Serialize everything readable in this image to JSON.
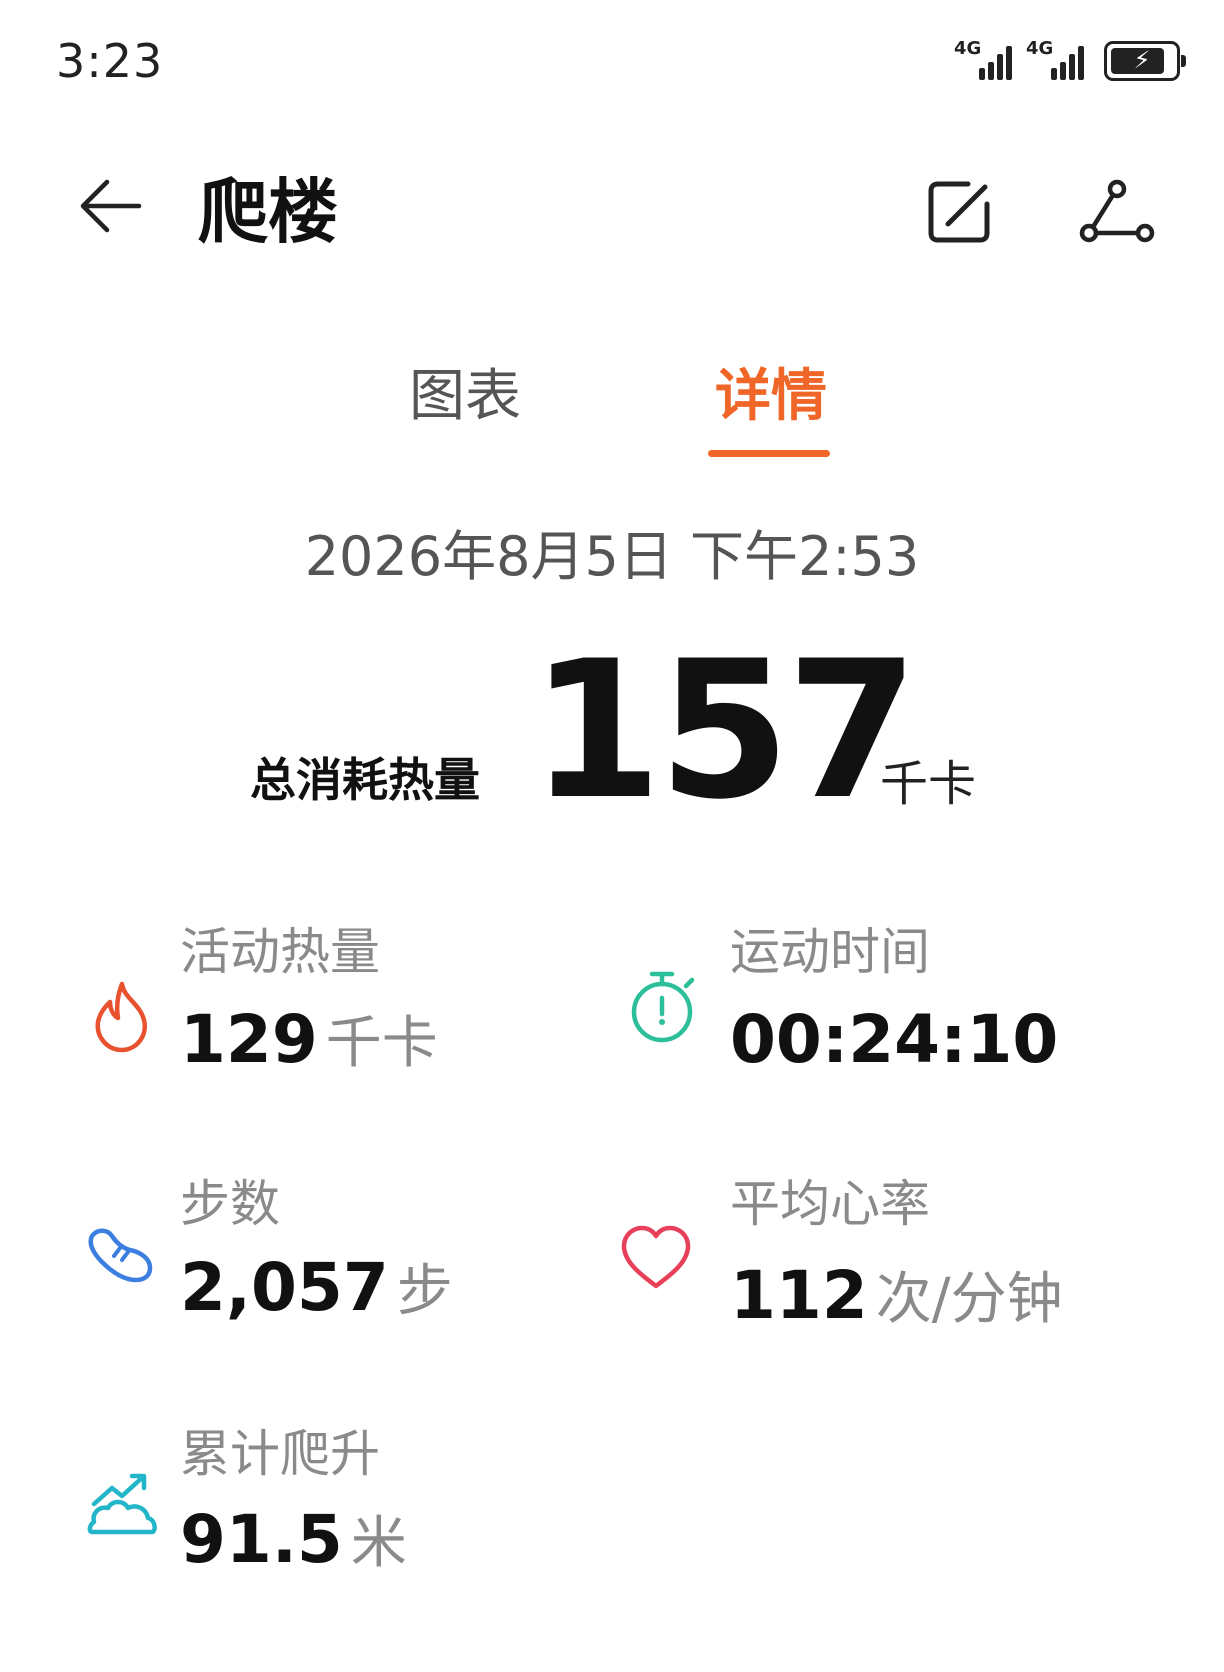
{
  "status_bar": {
    "time": "3:23",
    "networks": [
      {
        "label": "4G",
        "icon": "signal-4g-icon"
      },
      {
        "label": "4G",
        "icon": "signal-4g-icon"
      }
    ],
    "battery_icon": "battery-charging-icon",
    "battery_level": 0.85
  },
  "header": {
    "title": "爬楼",
    "back_icon": "arrow-left-icon",
    "edit_icon": "edit-note-icon",
    "share_icon": "share-icon"
  },
  "tabs": [
    {
      "label": "图表",
      "active": false
    },
    {
      "label": "详情",
      "active": true
    }
  ],
  "record": {
    "datetime": "2026年8月5日 下午2:53"
  },
  "total": {
    "label": "总消耗热量",
    "value": "157",
    "unit": "千卡"
  },
  "metrics": [
    {
      "label": "活动热量",
      "value": "129",
      "unit": "千卡",
      "icon": "flame-icon",
      "color": "#e8522e"
    },
    {
      "label": "运动时间",
      "value": "00:24:10",
      "unit": "",
      "icon": "stopwatch-icon",
      "color": "#2dbf9a"
    },
    {
      "label": "步数",
      "value": "2,057",
      "unit": "步",
      "icon": "shoe-icon",
      "color": "#3d7fe0"
    },
    {
      "label": "平均心率",
      "value": "112",
      "unit": "次/分钟",
      "icon": "heart-icon",
      "color": "#e8405a"
    },
    {
      "label": "累计爬升",
      "value": "91.5",
      "unit": "米",
      "icon": "climb-icon",
      "color": "#22b6c8"
    }
  ],
  "colors": {
    "accent": "#f06628",
    "text_primary": "#111111",
    "text_secondary": "#8a8a8a"
  }
}
